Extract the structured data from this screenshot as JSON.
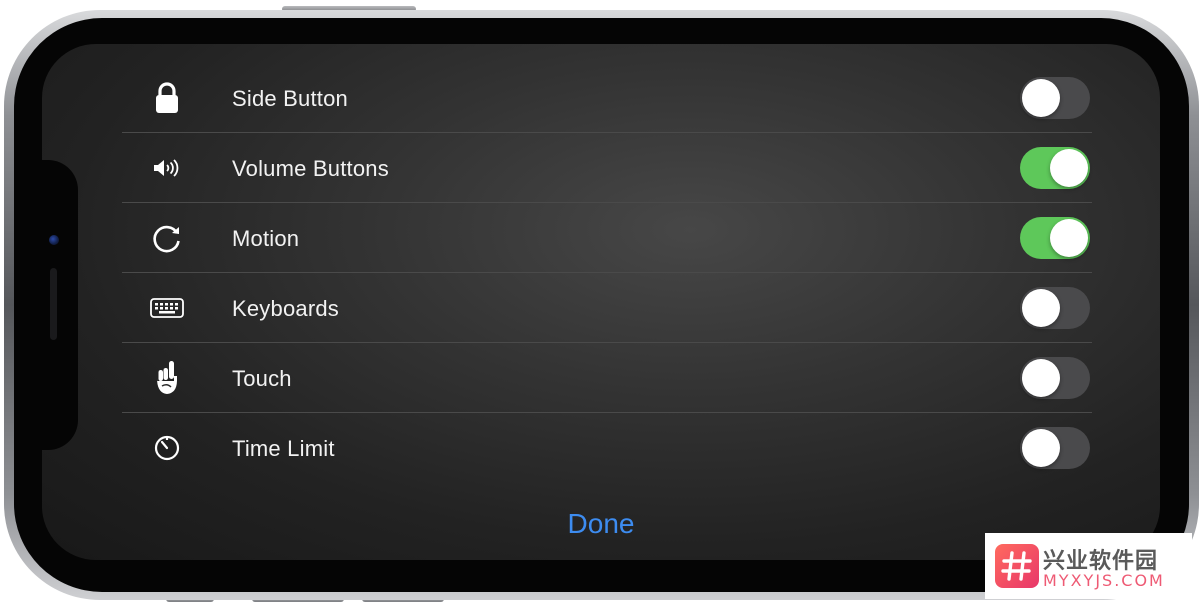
{
  "rows": [
    {
      "icon": "lock-icon",
      "label": "Side Button",
      "enabled": false
    },
    {
      "icon": "speaker-volume-icon",
      "label": "Volume Buttons",
      "enabled": true
    },
    {
      "icon": "rotate-icon",
      "label": "Motion",
      "enabled": true
    },
    {
      "icon": "keyboard-icon",
      "label": "Keyboards",
      "enabled": false
    },
    {
      "icon": "hand-touch-icon",
      "label": "Touch",
      "enabled": false
    },
    {
      "icon": "timer-icon",
      "label": "Time Limit",
      "enabled": false
    }
  ],
  "done_label": "Done",
  "colors": {
    "toggle_on": "#5ec85a",
    "toggle_off": "#4a4a4c",
    "done_link": "#3d8cf0",
    "screen_bg": "#2a2a2a"
  },
  "watermark": {
    "title": "兴业软件园",
    "url": "MYXYJS.COM"
  }
}
